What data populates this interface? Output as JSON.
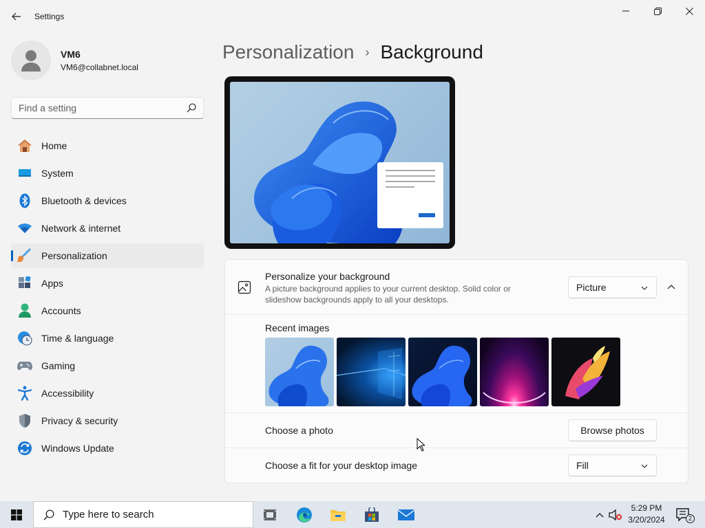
{
  "window": {
    "title": "Settings"
  },
  "profile": {
    "name": "VM6",
    "email": "VM6@collabnet.local"
  },
  "search": {
    "placeholder": "Find a setting"
  },
  "sidebar": {
    "items": [
      {
        "label": "Home",
        "icon": "home-icon",
        "selected": false
      },
      {
        "label": "System",
        "icon": "system-icon",
        "selected": false
      },
      {
        "label": "Bluetooth & devices",
        "icon": "bluetooth-icon",
        "selected": false
      },
      {
        "label": "Network & internet",
        "icon": "wifi-icon",
        "selected": false
      },
      {
        "label": "Personalization",
        "icon": "brush-icon",
        "selected": true
      },
      {
        "label": "Apps",
        "icon": "apps-icon",
        "selected": false
      },
      {
        "label": "Accounts",
        "icon": "person-icon",
        "selected": false
      },
      {
        "label": "Time & language",
        "icon": "globe-clock-icon",
        "selected": false
      },
      {
        "label": "Gaming",
        "icon": "gamepad-icon",
        "selected": false
      },
      {
        "label": "Accessibility",
        "icon": "accessibility-icon",
        "selected": false
      },
      {
        "label": "Privacy & security",
        "icon": "shield-icon",
        "selected": false
      },
      {
        "label": "Windows Update",
        "icon": "update-icon",
        "selected": false
      }
    ]
  },
  "breadcrumb": {
    "parent": "Personalization",
    "separator": "›",
    "current": "Background"
  },
  "background_card": {
    "title": "Personalize your background",
    "description": "A picture background applies to your current desktop. Solid color or slideshow backgrounds apply to all your desktops.",
    "type_value": "Picture",
    "recent_label": "Recent images",
    "recent_images": [
      "bloom-blue-light",
      "windows-10-hero",
      "bloom-blue-dark",
      "purple-glow",
      "colorful-ribbon"
    ],
    "choose_photo_label": "Choose a photo",
    "browse_button": "Browse photos",
    "fit_label": "Choose a fit for your desktop image",
    "fit_value": "Fill"
  },
  "taskbar": {
    "search_placeholder": "Type here to search",
    "apps": [
      "task-view-icon",
      "edge-icon",
      "file-explorer-icon",
      "store-icon",
      "mail-icon"
    ],
    "time": "5:29 PM",
    "date": "3/20/2024",
    "notification_count": "2"
  },
  "colors": {
    "accent": "#005fb8",
    "window_bg": "#f3f3f3",
    "card_bg": "#fbfbfb",
    "taskbar_bg": "#dfe6ee"
  }
}
